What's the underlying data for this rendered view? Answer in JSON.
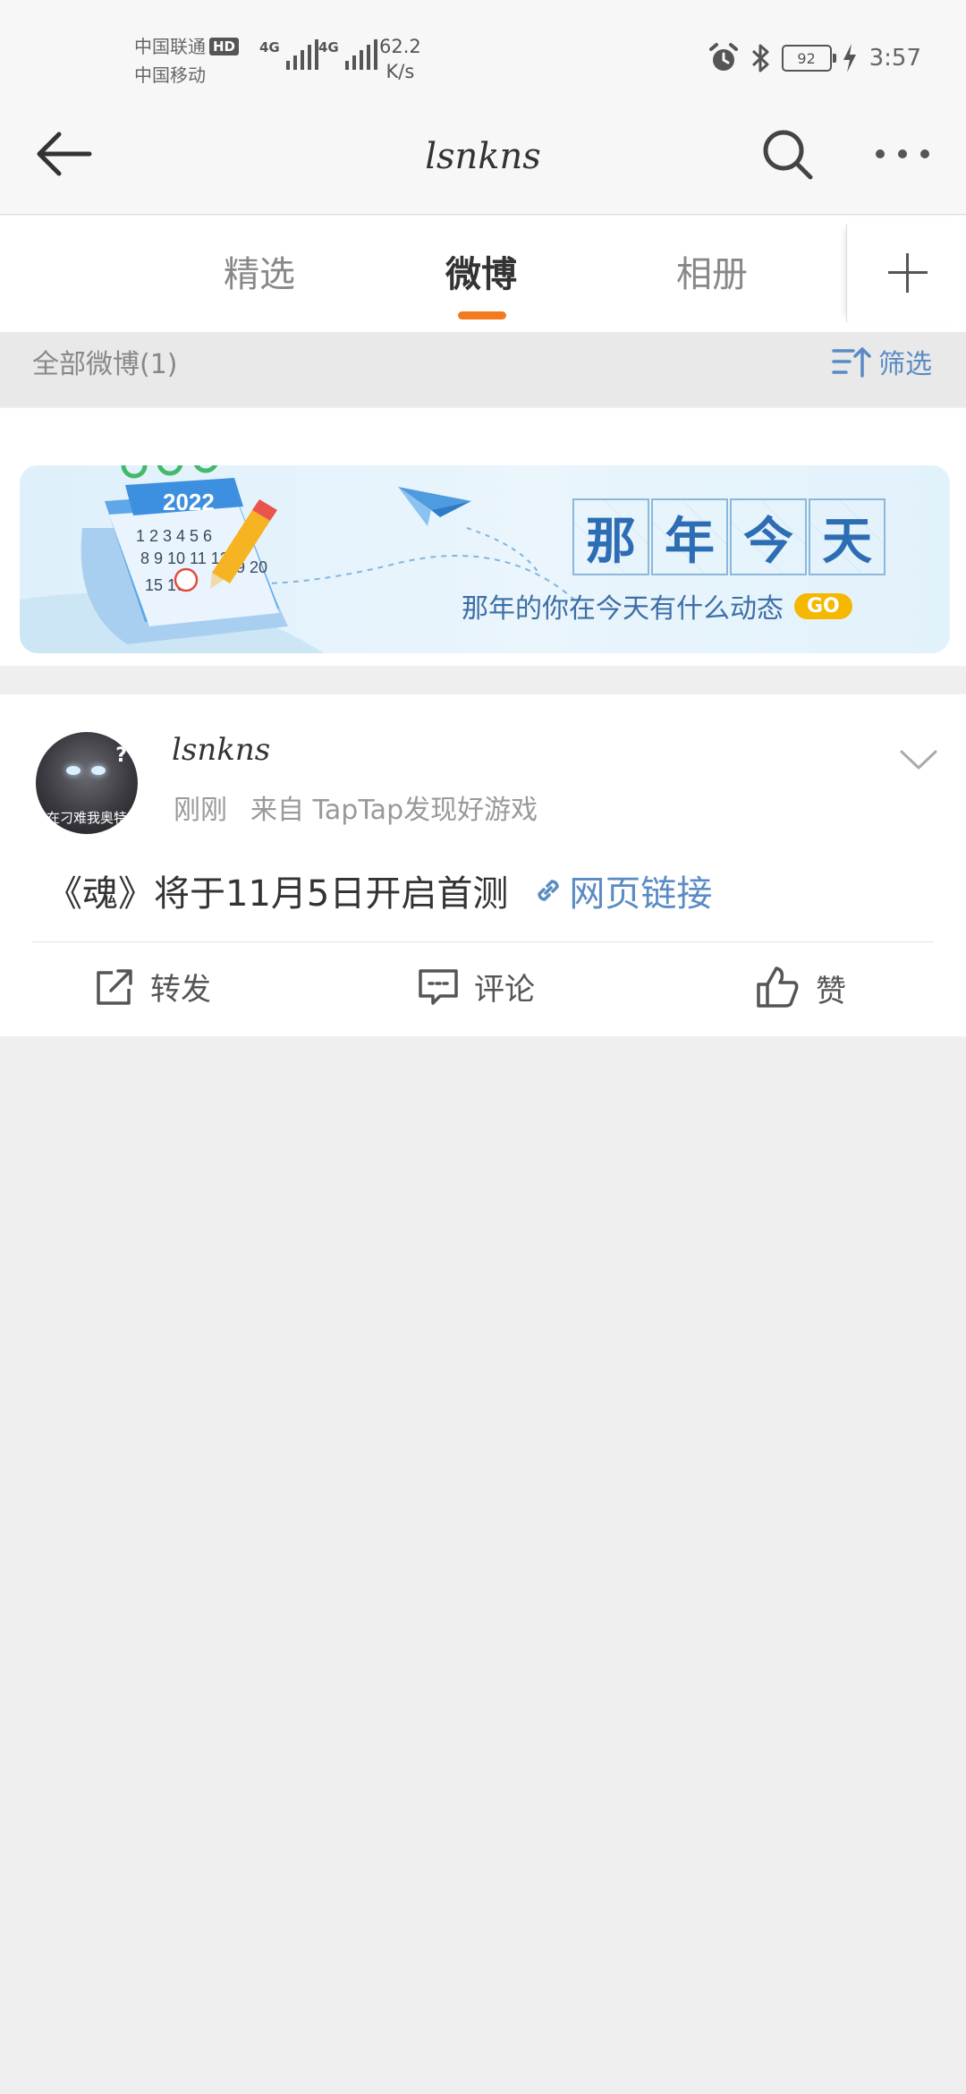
{
  "status_bar": {
    "carrier_1": "中国联通",
    "hd": "HD",
    "carrier_2": "中国移动",
    "network_1": "4G",
    "network_2": "4G",
    "speed_value": "62.2",
    "speed_unit": "K/s",
    "battery": "92",
    "time": "3:57",
    "icons": [
      "alarm-icon",
      "bluetooth-icon",
      "battery-icon",
      "charging-icon"
    ]
  },
  "header": {
    "title": "lsnkns",
    "icons": [
      "back-arrow-icon",
      "search-icon",
      "more-icon"
    ]
  },
  "tabs": {
    "items": [
      {
        "label": "精选",
        "active": false
      },
      {
        "label": "微博",
        "active": true
      },
      {
        "label": "相册",
        "active": false
      }
    ],
    "accent_color": "#f37b1d"
  },
  "filter_row": {
    "all_label": "全部微博(1)",
    "filter_label": "筛选"
  },
  "banner": {
    "calendar_year": "2022",
    "title_chars": [
      "那",
      "年",
      "今",
      "天"
    ],
    "subtitle": "那年的你在今天有什么动态",
    "go_label": "GO"
  },
  "post": {
    "author": "lsnkns",
    "time": "刚刚",
    "source": "来自 TapTap发现好游戏",
    "avatar_caption": "在刁难我奥特",
    "text": "《魂》将于11月5日开启首测",
    "link_label": "网页链接",
    "link_color": "#5b8bc4",
    "actions": [
      {
        "label": "转发",
        "icon": "repost-icon"
      },
      {
        "label": "评论",
        "icon": "comment-icon"
      },
      {
        "label": "赞",
        "icon": "like-icon"
      }
    ]
  }
}
